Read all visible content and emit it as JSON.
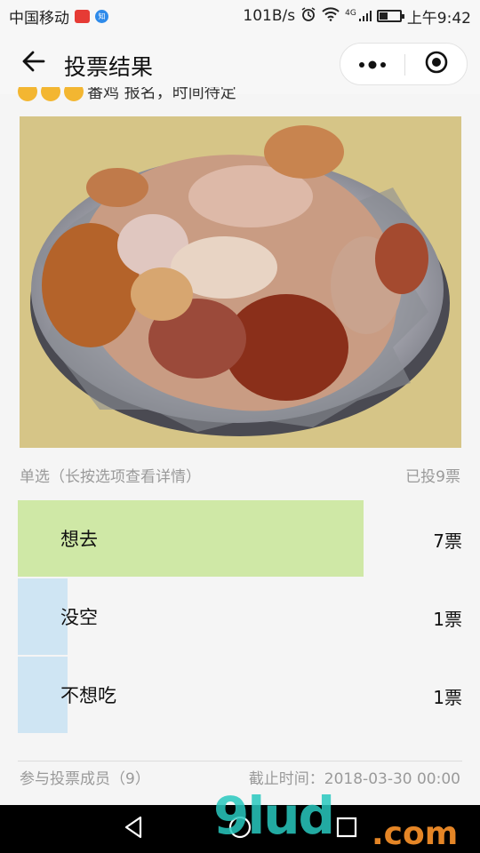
{
  "status_bar": {
    "carrier": "中国移动",
    "badge1": " ",
    "badge2": "知",
    "speed": "101B/s",
    "network": "4G",
    "time": "上午9:42"
  },
  "nav": {
    "title": "投票结果"
  },
  "description": {
    "text": "番鸡 报名，时间待定"
  },
  "poll": {
    "type_label": "单选（长按选项查看详情）",
    "total_label": "已投9票",
    "options": [
      {
        "label": "想去",
        "count": "7票",
        "fraction": 0.778,
        "color": "#cfe8a6"
      },
      {
        "label": "没空",
        "count": "1票",
        "fraction": 0.111,
        "color": "#cfe5f3"
      },
      {
        "label": "不想吃",
        "count": "1票",
        "fraction": 0.111,
        "color": "#cfe5f3"
      }
    ],
    "members_label": "参与投票成员（9）",
    "deadline_label": "截止时间：2018-03-30 00:00"
  },
  "watermark": {
    "text1": "9lud",
    "text2": ".com"
  },
  "icons": {
    "back": "arrow-left-icon",
    "more": "more-dots-icon",
    "close": "target-close-icon",
    "nav_back": "triangle-back-icon",
    "nav_home": "circle-home-icon",
    "nav_recent": "square-recent-icon"
  }
}
